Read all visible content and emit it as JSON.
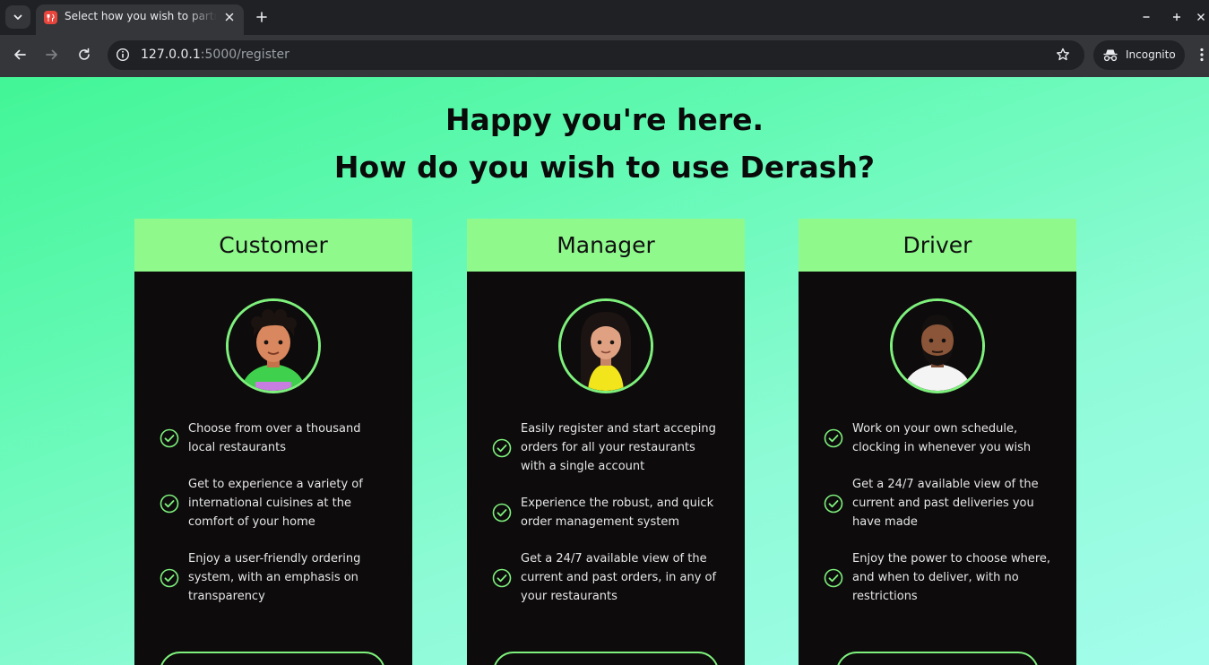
{
  "browser": {
    "tab_title": "Select how you wish to partner with Derash",
    "url_host": "127.0.0.1",
    "url_path": ":5000/register",
    "incognito_label": "Incognito"
  },
  "page": {
    "heading_line1": "Happy you're here.",
    "heading_line2": "How do you wish to use Derash?"
  },
  "colors": {
    "accent": "#8ff98c",
    "check": "#7ef17d",
    "card_bg": "#0d0b0b",
    "gradient_start": "#42f596",
    "gradient_end": "#a3fdeb"
  },
  "cards": [
    {
      "title": "Customer",
      "avatar": "customer-avatar",
      "features": [
        "Choose from over a thousand local restaurants",
        "Get to experience a variety of international cuisines at the comfort of your home",
        "Enjoy a user-friendly ordering system, with an emphasis on transparency"
      ]
    },
    {
      "title": "Manager",
      "avatar": "manager-avatar",
      "features": [
        "Easily register and start acceping orders for all your restaurants with a single account",
        "Experience the robust, and quick order management system",
        "Get a 24/7 available view of the current and past orders, in any of your restaurants"
      ]
    },
    {
      "title": "Driver",
      "avatar": "driver-avatar",
      "features": [
        "Work on your own schedule, clocking in whenever you wish",
        "Get a 24/7 available view of the current and past deliveries you have made",
        "Enjoy the power to choose where, and when to deliver, with no restrictions"
      ]
    }
  ]
}
